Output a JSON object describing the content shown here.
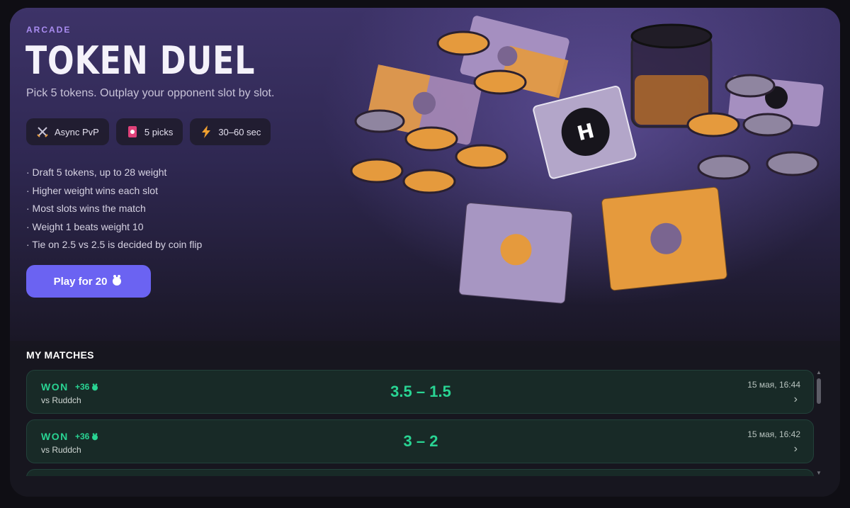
{
  "hero": {
    "kicker": "ARCADE",
    "title": "TOKEN DUEL",
    "subtitle": "Pick 5 tokens. Outplay your opponent slot by slot.",
    "chips": [
      {
        "icon": "crossed-swords-icon",
        "label": "Async PvP"
      },
      {
        "icon": "cards-icon",
        "label": "5 picks"
      },
      {
        "icon": "lightning-icon",
        "label": "30–60 sec"
      }
    ],
    "rules": [
      "· Draft 5 tokens, up to 28 weight",
      "· Higher weight wins each slot",
      "· Most slots wins the match",
      "· Weight 1 beats weight 10",
      "· Tie on 2.5 vs 2.5 is decided by coin flip"
    ],
    "play_label": "Play for 20",
    "card_logo": "H"
  },
  "matches": {
    "heading": "MY MATCHES",
    "items": [
      {
        "result": "WON",
        "delta": "+36",
        "opponent": "vs Ruddch",
        "score": "3.5 – 1.5",
        "time": "15 мая, 16:44"
      },
      {
        "result": "WON",
        "delta": "+36",
        "opponent": "vs Ruddch",
        "score": "3 – 2",
        "time": "15 мая, 16:42"
      }
    ]
  },
  "colors": {
    "accent": "#6b63f2",
    "win": "#29d493",
    "kicker": "#a98cf0"
  }
}
